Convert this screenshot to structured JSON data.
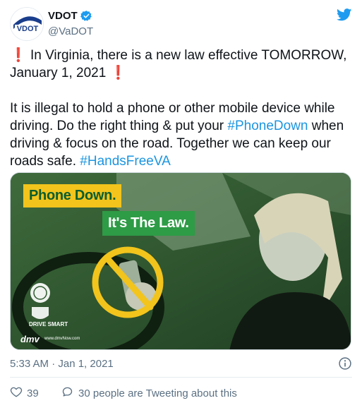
{
  "account": {
    "display_name": "VDOT",
    "handle": "@VaDOT",
    "avatar_text": "VDOT",
    "verified_icon": "verified-badge-icon",
    "brand_color": "#1d9bf0"
  },
  "tweet": {
    "line1": "In Virginia, there is a new law effective TOMORROW, January 1, 2021",
    "excl_left": "❗",
    "excl_right": "❗",
    "body_pre": "It is illegal to hold a phone or other mobile device while driving. Do the right thing & put your ",
    "hashtag1": "#PhoneDown",
    "body_mid": " when driving & focus on the road. Together we can keep our roads safe. ",
    "hashtag2": "#HandsFreeVA"
  },
  "media": {
    "banner_line1": "Phone Down.",
    "banner_line2": "It's The Law.",
    "logo_drive_smart": "DRIVE SMART",
    "logo_dmv": "dmv",
    "dmv_url": "www.dmvNow.com",
    "colors": {
      "yellow": "#f2c41c",
      "green": "#2e9b46",
      "dark_green": "#0b5d2e"
    }
  },
  "meta": {
    "timestamp": "5:33 AM · Jan 1, 2021"
  },
  "actions": {
    "likes_count": "39",
    "replies_text": "30 people are Tweeting about this"
  }
}
